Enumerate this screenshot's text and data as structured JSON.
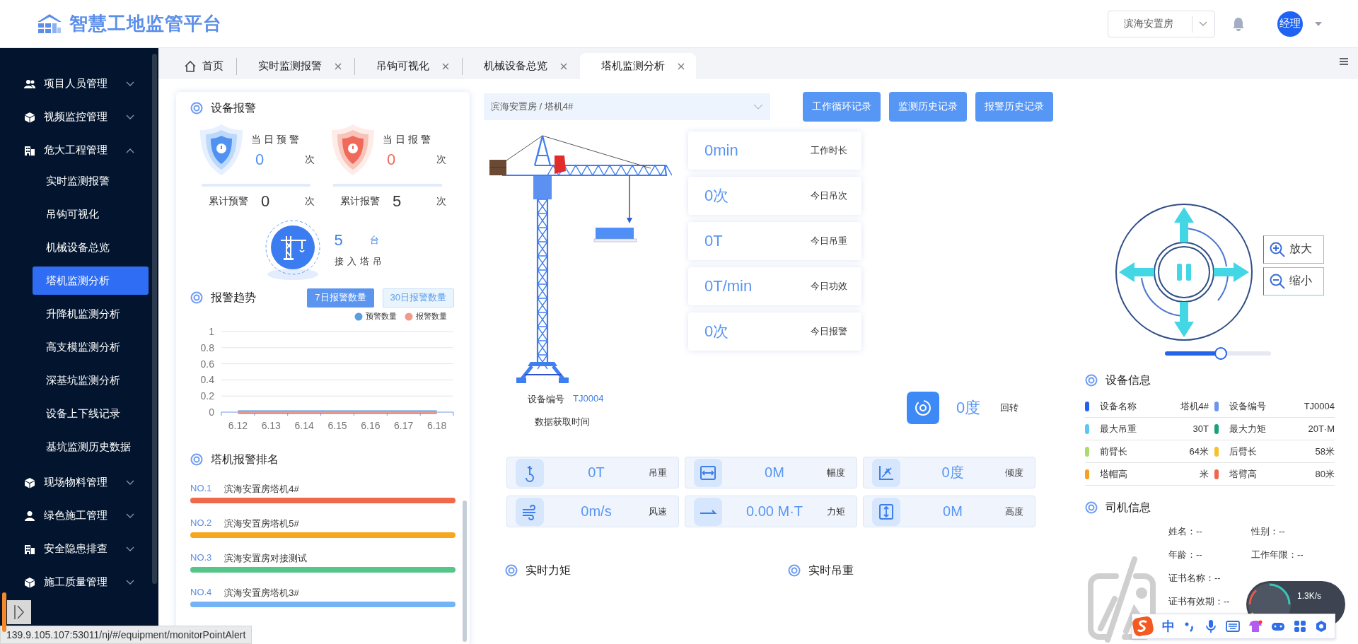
{
  "header": {
    "title": "智慧工地监管平台",
    "project_select": {
      "value": "滨海安置房"
    },
    "user": {
      "avatar": "经理"
    }
  },
  "sidebar": {
    "items": [
      {
        "label": "项目人员管理",
        "expanded": false
      },
      {
        "label": "视频监控管理",
        "expanded": false
      },
      {
        "label": "危大工程管理",
        "expanded": true,
        "children": [
          {
            "label": "实时监测报警",
            "selected": false
          },
          {
            "label": "吊钩可视化",
            "selected": false
          },
          {
            "label": "机械设备总览",
            "selected": false
          },
          {
            "label": "塔机监测分析",
            "selected": true
          },
          {
            "label": "升降机监测分析",
            "selected": false
          },
          {
            "label": "高支模监测分析",
            "selected": false
          },
          {
            "label": "深基坑监测分析",
            "selected": false
          },
          {
            "label": "设备上下线记录",
            "selected": false
          },
          {
            "label": "基坑监测历史数据",
            "selected": false
          }
        ]
      },
      {
        "label": "现场物料管理",
        "expanded": false
      },
      {
        "label": "绿色施工管理",
        "expanded": false
      },
      {
        "label": "安全隐患排查",
        "expanded": false
      },
      {
        "label": "施工质量管理",
        "expanded": false
      }
    ]
  },
  "tabs": [
    {
      "label": "首页",
      "selected": false,
      "closable": false
    },
    {
      "label": "实时监测报警",
      "selected": false,
      "closable": true
    },
    {
      "label": "吊钩可视化",
      "selected": false,
      "closable": true
    },
    {
      "label": "机械设备总览",
      "selected": false,
      "closable": true
    },
    {
      "label": "塔机监测分析",
      "selected": true,
      "closable": true
    }
  ],
  "alarm_panel": {
    "title": "设备报警",
    "cards": [
      {
        "kind": "warning",
        "label": "当日预警",
        "value": "0",
        "unit": "次",
        "total_label": "累计预警",
        "total_value": "0",
        "total_unit": "次"
      },
      {
        "kind": "alarm",
        "label": "当日报警",
        "value": "0",
        "unit": "次",
        "total_label": "累计报警",
        "total_value": "5",
        "total_unit": "次"
      }
    ],
    "cranes": {
      "value": "5",
      "unit": "台",
      "label": "接入塔吊"
    }
  },
  "trend": {
    "title": "报警趋势",
    "ranges": [
      {
        "label": "7日报警数量",
        "selected": true
      },
      {
        "label": "30日报警数量",
        "selected": false
      }
    ],
    "chart_data": {
      "type": "line",
      "grid": true,
      "legend": true,
      "categories": [
        "6.12",
        "6.13",
        "6.14",
        "6.15",
        "6.16",
        "6.17",
        "6.18"
      ],
      "ylim": [
        0,
        1
      ],
      "yticks": [
        0,
        0.2,
        0.4,
        0.6,
        0.8,
        1
      ],
      "series": [
        {
          "name": "预警数量",
          "color": "#5a9ee0",
          "values": [
            0,
            0,
            0,
            0,
            0,
            0,
            0
          ]
        },
        {
          "name": "报警数量",
          "color": "#f19a8a",
          "values": [
            0,
            0,
            0,
            0,
            0,
            0,
            0
          ]
        }
      ]
    }
  },
  "ranking": {
    "title": "塔机报警排名",
    "items": [
      {
        "rank": "NO.1",
        "name": "滨海安置房塔机4#",
        "color": "#f0694a"
      },
      {
        "rank": "NO.2",
        "name": "滨海安置房塔机5#",
        "color": "#f6a81c"
      },
      {
        "rank": "NO.3",
        "name": "滨海安置房对接测试",
        "color": "#55c58a"
      },
      {
        "rank": "NO.4",
        "name": "滨海安置房塔机3#",
        "color": "#74b3f5"
      }
    ]
  },
  "device_select": {
    "value": "滨海安置房 / 塔机4#"
  },
  "actions": [
    "工作循环记录",
    "监测历史记录",
    "报警历史记录"
  ],
  "crane": {
    "code_label": "设备编号",
    "code": "TJ0004",
    "time_label": "数据获取时间"
  },
  "daily_stats": [
    {
      "value": "0min",
      "label": "工作时长"
    },
    {
      "value": "0次",
      "label": "今日吊次"
    },
    {
      "value": "0T",
      "label": "今日吊重"
    },
    {
      "value": "0T/min",
      "label": "今日功效"
    },
    {
      "value": "0次",
      "label": "今日报警"
    }
  ],
  "rotation": {
    "value": "0度",
    "label": "回转"
  },
  "metrics": [
    {
      "kind": "hook",
      "reading": "0T",
      "caption": "吊重"
    },
    {
      "kind": "range",
      "reading": "0M",
      "caption": "幅度"
    },
    {
      "kind": "tilt",
      "reading": "0度",
      "caption": "倾度"
    },
    {
      "kind": "wind",
      "reading": "0m/s",
      "caption": "风速"
    },
    {
      "kind": "torque",
      "reading": "0.00 M·T",
      "caption": "力矩"
    },
    {
      "kind": "height",
      "reading": "0M",
      "caption": "高度"
    }
  ],
  "realtime": [
    "实时力矩",
    "实时吊重"
  ],
  "camera_control": {
    "zoom_in": "放大",
    "zoom_out": "缩小",
    "speed": {
      "level": 0.52
    }
  },
  "device_info": {
    "title": "设备信息",
    "rows": [
      {
        "label": "设备名称",
        "value": "塔机4#",
        "color": "#2560ef"
      },
      {
        "label": "设备编号",
        "value": "TJ0004",
        "color": "#6b95ee"
      },
      {
        "label": "最大吊重",
        "value": "30T",
        "color": "#5cc6f7"
      },
      {
        "label": "最大力矩",
        "value": "20T·M",
        "color": "#17a27a"
      },
      {
        "label": "前臂长",
        "value": "64米",
        "color": "#a8dd6c"
      },
      {
        "label": "后臂长",
        "value": "58米",
        "color": "#f5c12c"
      },
      {
        "label": "塔帽高",
        "value": "米",
        "color": "#f6a024"
      },
      {
        "label": "塔臂高",
        "value": "80米",
        "color": "#ef664b"
      }
    ]
  },
  "driver_info": {
    "title": "司机信息",
    "fields": [
      "姓名：--",
      "性别：--",
      "年龄：--",
      "工作年限：--",
      "证书名称：--",
      "证书有效期：--"
    ]
  },
  "status_url": "139.9.105.107:53011/nj/#/equipment/monitorPointAlert",
  "ime_bar": {
    "mode": "中"
  },
  "net_speed": "1.3K/s"
}
